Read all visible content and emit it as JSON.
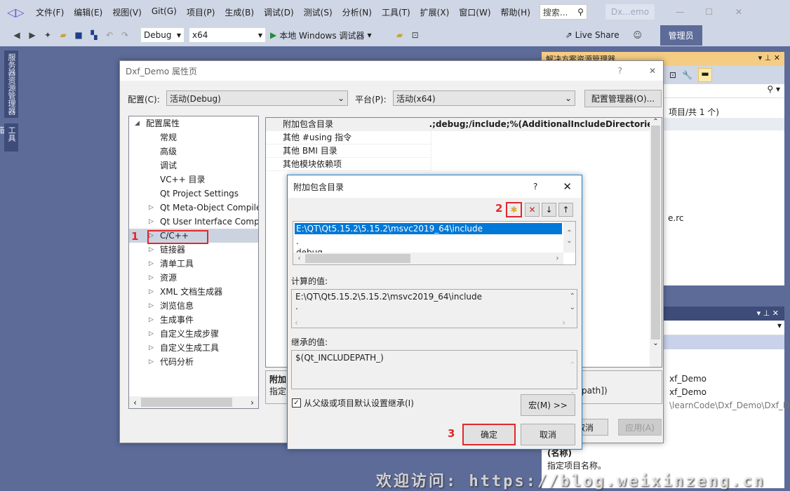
{
  "menubar": {
    "items": [
      "文件(F)",
      "编辑(E)",
      "视图(V)",
      "Git(G)",
      "项目(P)",
      "生成(B)",
      "调试(D)",
      "测试(S)",
      "分析(N)",
      "工具(T)",
      "扩展(X)",
      "窗口(W)",
      "帮助(H)"
    ],
    "search_placeholder": "搜索...",
    "solution_name": "Dx...emo"
  },
  "toolbar": {
    "config": "Debug",
    "platform": "x64",
    "run_label": "本地 Windows 调试器",
    "live_share": "Live Share",
    "admin": "管理员"
  },
  "side_tabs": [
    "服务器资源管理器",
    "工具箱"
  ],
  "prop_page": {
    "title": "Dxf_Demo 属性页",
    "help": "?",
    "config_label": "配置(C):",
    "config_value": "活动(Debug)",
    "platform_label": "平台(P):",
    "platform_value": "活动(x64)",
    "config_manager": "配置管理器(O)...",
    "tree_root": "配置属性",
    "tree": [
      {
        "label": "常规",
        "exp": false
      },
      {
        "label": "高级",
        "exp": false
      },
      {
        "label": "调试",
        "exp": false
      },
      {
        "label": "VC++ 目录",
        "exp": false
      },
      {
        "label": "Qt Project Settings",
        "exp": false
      },
      {
        "label": "Qt Meta-Object Compiler",
        "exp": true
      },
      {
        "label": "Qt User Interface Compiler",
        "exp": true
      },
      {
        "label": "C/C++",
        "exp": true,
        "selected": true
      },
      {
        "label": "链接器",
        "exp": true
      },
      {
        "label": "清单工具",
        "exp": true
      },
      {
        "label": "资源",
        "exp": true
      },
      {
        "label": "XML 文档生成器",
        "exp": true
      },
      {
        "label": "浏览信息",
        "exp": true
      },
      {
        "label": "生成事件",
        "exp": true
      },
      {
        "label": "自定义生成步骤",
        "exp": true
      },
      {
        "label": "自定义生成工具",
        "exp": true
      },
      {
        "label": "代码分析",
        "exp": true
      }
    ],
    "grid": [
      {
        "name": "附加包含目录",
        "value": ".;debug;/include;%(AdditionalIncludeDirectories)"
      },
      {
        "name": "其他 #using 指令",
        "value": ""
      },
      {
        "name": "其他 BMI 目录",
        "value": ""
      },
      {
        "name": "其他模块依赖项",
        "value": ""
      }
    ],
    "desc_title": "附加",
    "desc_text": "指定",
    "desc_tail": "path])",
    "cancel": "取消",
    "apply": "应用(A)"
  },
  "dialog": {
    "title": "附加包含目录",
    "help": "?",
    "list": [
      "E:\\QT\\Qt5.15.2\\5.15.2\\msvc2019_64\\include",
      ".",
      "debug"
    ],
    "computed_label": "计算的值:",
    "computed": [
      "E:\\QT\\Qt5.15.2\\5.15.2\\msvc2019_64\\include",
      "."
    ],
    "inherited_label": "继承的值:",
    "inherited": [
      "$(Qt_INCLUDEPATH_)"
    ],
    "inherit_checkbox": "从父级或项目默认设置继承(I)",
    "inherit_checked": true,
    "macros": "宏(M) >>",
    "ok": "确定",
    "cancel": "取消"
  },
  "annotations": [
    "1",
    "2",
    "3"
  ],
  "solution_explorer": {
    "title": "解决方案资源管理器",
    "count_text": "项目/共 1 个)",
    "file": "e.rc"
  },
  "properties_panel": {
    "rows": [
      "xf_Demo",
      "xf_Demo",
      "\\learnCode\\Dxf_Demo\\Dxf_D"
    ],
    "name_label": "(名称)",
    "desc": "指定项目名称。"
  },
  "watermark": "欢迎访问: https://blog.weixinzeng.cn",
  "colors": {
    "accent": "#007acc",
    "selection": "#0078d7",
    "annotation": "#e0282e",
    "ide_background": "#5d6b99"
  }
}
